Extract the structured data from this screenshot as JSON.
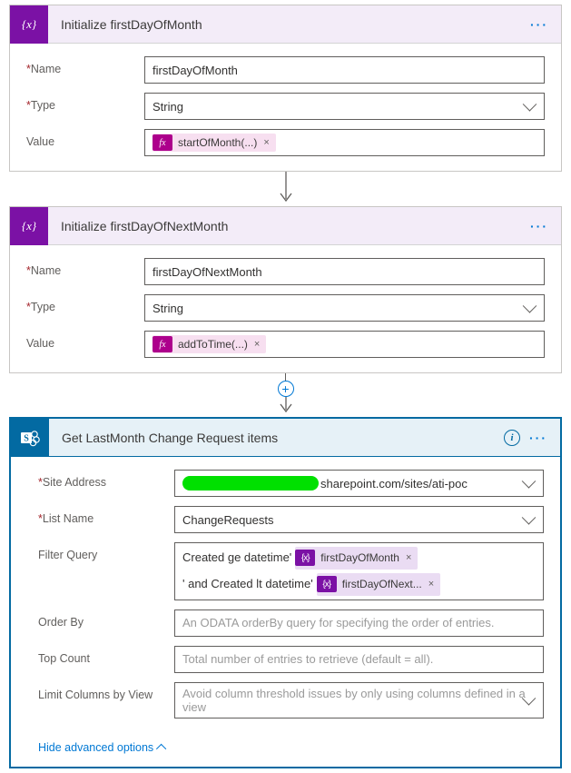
{
  "card1": {
    "title": "Initialize firstDayOfMonth",
    "name_label": "Name",
    "name_value": "firstDayOfMonth",
    "type_label": "Type",
    "type_value": "String",
    "value_label": "Value",
    "fx_expr": "startOfMonth(...)"
  },
  "card2": {
    "title": "Initialize firstDayOfNextMonth",
    "name_label": "Name",
    "name_value": "firstDayOfNextMonth",
    "type_label": "Type",
    "type_value": "String",
    "value_label": "Value",
    "fx_expr": "addToTime(...)"
  },
  "card3": {
    "title": "Get LastMonth Change Request items",
    "site_label": "Site Address",
    "site_value": "sharepoint.com/sites/ati-poc",
    "list_label": "List Name",
    "list_value": "ChangeRequests",
    "filter_label": "Filter Query",
    "filter_pre": "Created ge datetime'",
    "filter_var1": "firstDayOfMonth",
    "filter_mid": "' and Created lt datetime'",
    "filter_var2": "firstDayOfNext...",
    "orderby_label": "Order By",
    "orderby_placeholder": "An ODATA orderBy query for specifying the order of entries.",
    "top_label": "Top Count",
    "top_placeholder": "Total number of entries to retrieve (default = all).",
    "limit_label": "Limit Columns by View",
    "limit_placeholder": "Avoid column threshold issues by only using columns defined in a view",
    "hide_label": "Hide advanced options"
  },
  "icons": {
    "fx": "fx",
    "var": "{x}",
    "info": "i",
    "more": "···",
    "x": "×",
    "plus": "+"
  }
}
